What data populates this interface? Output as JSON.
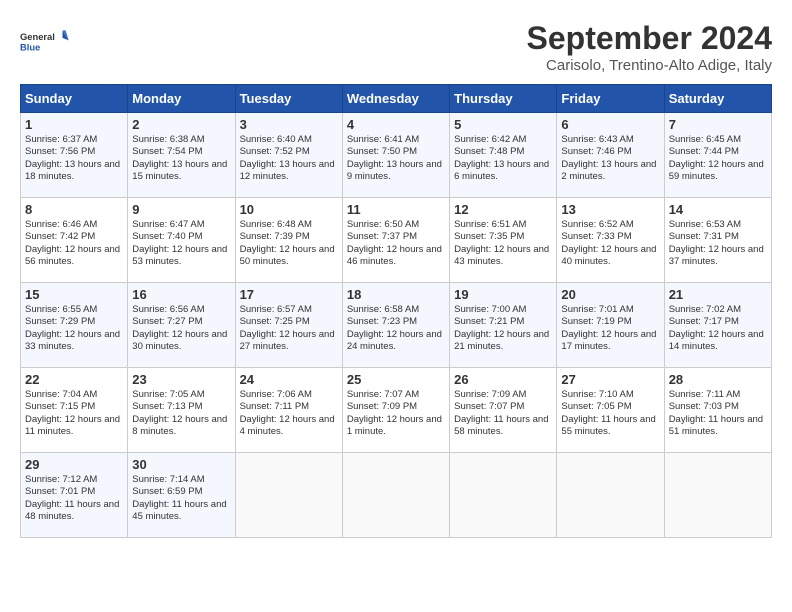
{
  "header": {
    "logo_line1": "General",
    "logo_line2": "Blue",
    "month": "September 2024",
    "location": "Carisolo, Trentino-Alto Adige, Italy"
  },
  "weekdays": [
    "Sunday",
    "Monday",
    "Tuesday",
    "Wednesday",
    "Thursday",
    "Friday",
    "Saturday"
  ],
  "weeks": [
    [
      {
        "day": "1",
        "sunrise": "6:37 AM",
        "sunset": "7:56 PM",
        "daylight": "13 hours and 18 minutes."
      },
      {
        "day": "2",
        "sunrise": "6:38 AM",
        "sunset": "7:54 PM",
        "daylight": "13 hours and 15 minutes."
      },
      {
        "day": "3",
        "sunrise": "6:40 AM",
        "sunset": "7:52 PM",
        "daylight": "13 hours and 12 minutes."
      },
      {
        "day": "4",
        "sunrise": "6:41 AM",
        "sunset": "7:50 PM",
        "daylight": "13 hours and 9 minutes."
      },
      {
        "day": "5",
        "sunrise": "6:42 AM",
        "sunset": "7:48 PM",
        "daylight": "13 hours and 6 minutes."
      },
      {
        "day": "6",
        "sunrise": "6:43 AM",
        "sunset": "7:46 PM",
        "daylight": "13 hours and 2 minutes."
      },
      {
        "day": "7",
        "sunrise": "6:45 AM",
        "sunset": "7:44 PM",
        "daylight": "12 hours and 59 minutes."
      }
    ],
    [
      {
        "day": "8",
        "sunrise": "6:46 AM",
        "sunset": "7:42 PM",
        "daylight": "12 hours and 56 minutes."
      },
      {
        "day": "9",
        "sunrise": "6:47 AM",
        "sunset": "7:40 PM",
        "daylight": "12 hours and 53 minutes."
      },
      {
        "day": "10",
        "sunrise": "6:48 AM",
        "sunset": "7:39 PM",
        "daylight": "12 hours and 50 minutes."
      },
      {
        "day": "11",
        "sunrise": "6:50 AM",
        "sunset": "7:37 PM",
        "daylight": "12 hours and 46 minutes."
      },
      {
        "day": "12",
        "sunrise": "6:51 AM",
        "sunset": "7:35 PM",
        "daylight": "12 hours and 43 minutes."
      },
      {
        "day": "13",
        "sunrise": "6:52 AM",
        "sunset": "7:33 PM",
        "daylight": "12 hours and 40 minutes."
      },
      {
        "day": "14",
        "sunrise": "6:53 AM",
        "sunset": "7:31 PM",
        "daylight": "12 hours and 37 minutes."
      }
    ],
    [
      {
        "day": "15",
        "sunrise": "6:55 AM",
        "sunset": "7:29 PM",
        "daylight": "12 hours and 33 minutes."
      },
      {
        "day": "16",
        "sunrise": "6:56 AM",
        "sunset": "7:27 PM",
        "daylight": "12 hours and 30 minutes."
      },
      {
        "day": "17",
        "sunrise": "6:57 AM",
        "sunset": "7:25 PM",
        "daylight": "12 hours and 27 minutes."
      },
      {
        "day": "18",
        "sunrise": "6:58 AM",
        "sunset": "7:23 PM",
        "daylight": "12 hours and 24 minutes."
      },
      {
        "day": "19",
        "sunrise": "7:00 AM",
        "sunset": "7:21 PM",
        "daylight": "12 hours and 21 minutes."
      },
      {
        "day": "20",
        "sunrise": "7:01 AM",
        "sunset": "7:19 PM",
        "daylight": "12 hours and 17 minutes."
      },
      {
        "day": "21",
        "sunrise": "7:02 AM",
        "sunset": "7:17 PM",
        "daylight": "12 hours and 14 minutes."
      }
    ],
    [
      {
        "day": "22",
        "sunrise": "7:04 AM",
        "sunset": "7:15 PM",
        "daylight": "12 hours and 11 minutes."
      },
      {
        "day": "23",
        "sunrise": "7:05 AM",
        "sunset": "7:13 PM",
        "daylight": "12 hours and 8 minutes."
      },
      {
        "day": "24",
        "sunrise": "7:06 AM",
        "sunset": "7:11 PM",
        "daylight": "12 hours and 4 minutes."
      },
      {
        "day": "25",
        "sunrise": "7:07 AM",
        "sunset": "7:09 PM",
        "daylight": "12 hours and 1 minute."
      },
      {
        "day": "26",
        "sunrise": "7:09 AM",
        "sunset": "7:07 PM",
        "daylight": "11 hours and 58 minutes."
      },
      {
        "day": "27",
        "sunrise": "7:10 AM",
        "sunset": "7:05 PM",
        "daylight": "11 hours and 55 minutes."
      },
      {
        "day": "28",
        "sunrise": "7:11 AM",
        "sunset": "7:03 PM",
        "daylight": "11 hours and 51 minutes."
      }
    ],
    [
      {
        "day": "29",
        "sunrise": "7:12 AM",
        "sunset": "7:01 PM",
        "daylight": "11 hours and 48 minutes."
      },
      {
        "day": "30",
        "sunrise": "7:14 AM",
        "sunset": "6:59 PM",
        "daylight": "11 hours and 45 minutes."
      },
      null,
      null,
      null,
      null,
      null
    ]
  ]
}
